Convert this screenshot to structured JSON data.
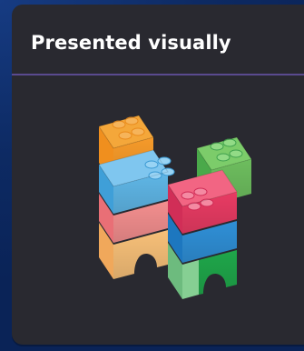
{
  "card": {
    "title": "Presented visually"
  },
  "illustration": {
    "icon": "lego-bricks-icon",
    "colors": {
      "orange": "#f59a2a",
      "green": "#6dbd5e",
      "blue": "#5fb6e6",
      "pink_red": "#e83b63",
      "light_red": "#f28e8e",
      "pale_orange": "#f6bf78",
      "pale_green": "#86cf93",
      "blue_dark": "#2f8fd6",
      "green_dark": "#1fa64a"
    }
  }
}
